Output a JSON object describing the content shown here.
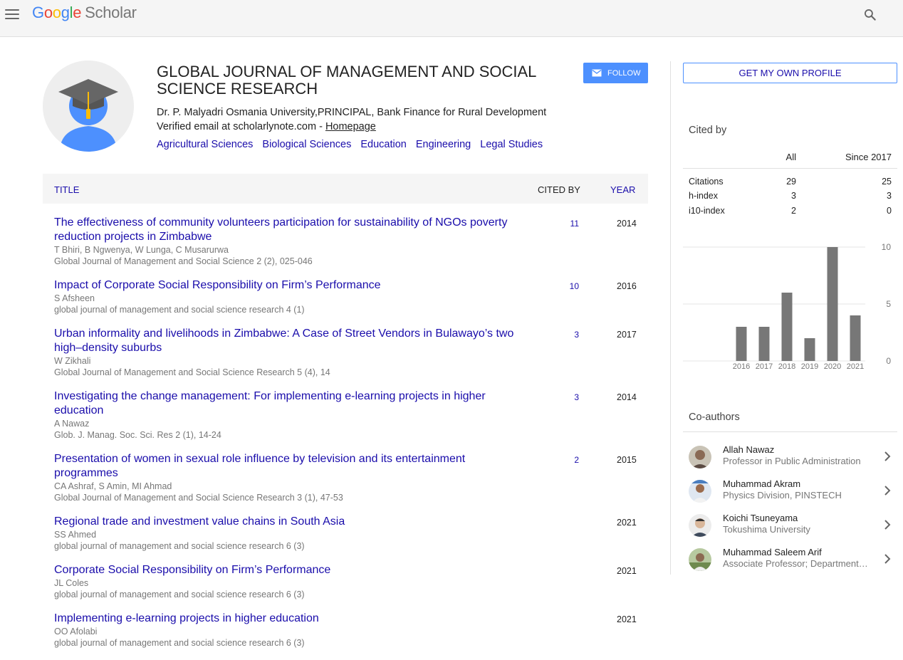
{
  "header": {
    "logo_letters": [
      "G",
      "o",
      "o",
      "g",
      "l",
      "e"
    ],
    "logo_colors": [
      "#4285f4",
      "#ea4335",
      "#fbbc05",
      "#4285f4",
      "#34a853",
      "#ea4335"
    ],
    "logo_suffix": "Scholar",
    "menu_icon": "hamburger-menu-icon",
    "search_icon": "search-icon"
  },
  "profile": {
    "name": "GLOBAL JOURNAL OF MANAGEMENT AND SOCIAL SCIENCE RESEARCH",
    "affiliation": "Dr. P. Malyadri Osmania University,PRINCIPAL, Bank Finance for Rural Development",
    "email_text": "Verified email at scholarlynote.com - ",
    "homepage_label": "Homepage",
    "interests": [
      "Agricultural Sciences",
      "Biological Sciences",
      "Education",
      "Engineering",
      "Legal Studies"
    ],
    "follow_label": "FOLLOW"
  },
  "table": {
    "headers": {
      "title": "TITLE",
      "cited_by": "CITED BY",
      "year": "YEAR"
    },
    "articles": [
      {
        "title": "The effectiveness of community volunteers participation for sustainability of NGOs poverty reduction projects in Zimbabwe",
        "authors": "T Bhiri, B Ngwenya, W Lunga, C Musarurwa",
        "venue": "Global Journal of Management and Social Science 2 (2), 025-046",
        "cited_by": "11",
        "year": "2014"
      },
      {
        "title": "Impact of Corporate Social Responsibility on Firm’s Performance",
        "authors": "S Afsheen",
        "venue": "global journal of management and social science research 4 (1)",
        "cited_by": "10",
        "year": "2016"
      },
      {
        "title": "Urban informality and livelihoods in Zimbabwe: A Case of Street Vendors in Bulawayo’s two high–density suburbs",
        "authors": "W Zikhali",
        "venue": "Global Journal of Management and Social Science Research 5 (4), 14",
        "cited_by": "3",
        "year": "2017"
      },
      {
        "title": "Investigating the change management: For implementing e-learning projects in higher education",
        "authors": "A Nawaz",
        "venue": "Glob. J. Manag. Soc. Sci. Res 2 (1), 14-24",
        "cited_by": "3",
        "year": "2014"
      },
      {
        "title": "Presentation of women in sexual role influence by television and its entertainment programmes",
        "authors": "CA Ashraf, S Amin, MI Ahmad",
        "venue": "Global Journal of Management and Social Science Research 3 (1), 47-53",
        "cited_by": "2",
        "year": "2015"
      },
      {
        "title": "Regional trade and investment value chains in South Asia",
        "authors": "SS Ahmed",
        "venue": "global journal of management and social science research 6 (3)",
        "cited_by": "",
        "year": "2021"
      },
      {
        "title": "Corporate Social Responsibility on Firm’s Performance",
        "authors": "JL Coles",
        "venue": "global journal of management and social science research 6 (3)",
        "cited_by": "",
        "year": "2021"
      },
      {
        "title": "Implementing e-learning projects in higher education",
        "authors": "OO Afolabi",
        "venue": "global journal of management and social science research 6 (3)",
        "cited_by": "",
        "year": "2021"
      }
    ]
  },
  "sidebar": {
    "own_profile_label": "GET MY OWN PROFILE",
    "cited_by_label": "Cited by",
    "columns": {
      "all": "All",
      "since": "Since 2017"
    },
    "metrics": [
      {
        "label": "Citations",
        "all": "29",
        "since": "25"
      },
      {
        "label": "h-index",
        "all": "3",
        "since": "3"
      },
      {
        "label": "i10-index",
        "all": "2",
        "since": "0"
      }
    ],
    "coauthors_label": "Co-authors",
    "coauthors": [
      {
        "name": "Allah Nawaz",
        "affiliation": "Professor in Public Administration"
      },
      {
        "name": "Muhammad Akram",
        "affiliation": "Physics Division, PINSTECH"
      },
      {
        "name": "Koichi Tsuneyama",
        "affiliation": "Tokushima University"
      },
      {
        "name": "Muhammad Saleem Arif",
        "affiliation": "Associate Professor; Department of ..."
      }
    ]
  },
  "chart_data": {
    "type": "bar",
    "categories": [
      "2016",
      "2017",
      "2018",
      "2019",
      "2020",
      "2021"
    ],
    "values": [
      3,
      3,
      6,
      2,
      10,
      4
    ],
    "ylim": [
      0,
      10
    ],
    "yticks": [
      "0",
      "5",
      "10"
    ],
    "bar_color": "#777777",
    "grid": true
  }
}
